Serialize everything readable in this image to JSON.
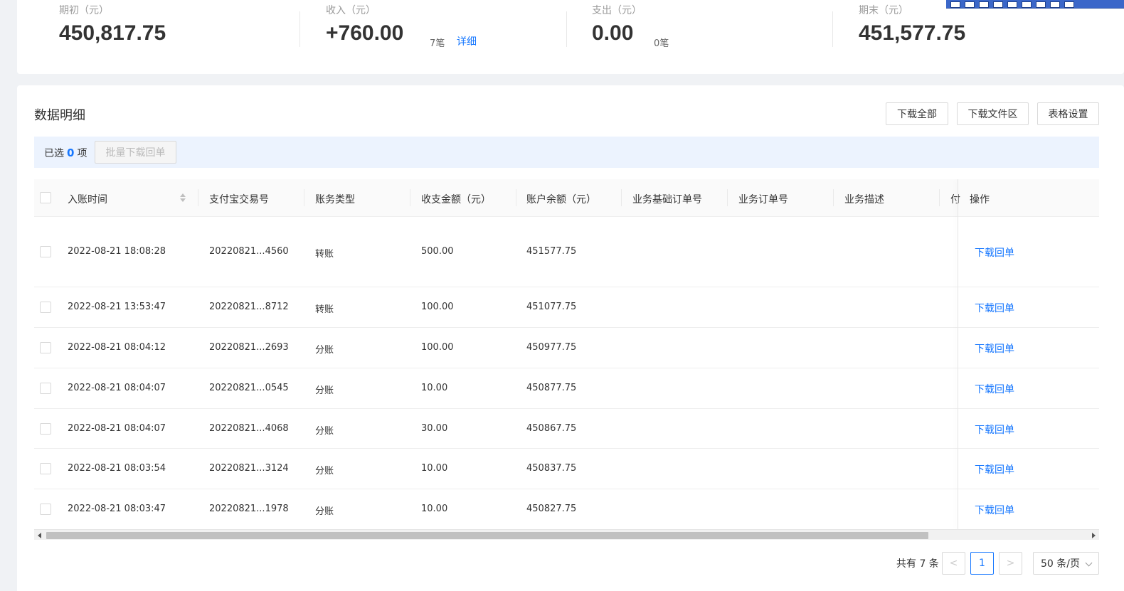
{
  "summary": {
    "opening": {
      "label": "期初（元）",
      "value": "450,817.75"
    },
    "income": {
      "label": "收入（元）",
      "value": "+760.00",
      "count": "7笔",
      "detail": "详细"
    },
    "expense": {
      "label": "支出（元）",
      "value": "0.00",
      "count": "0笔"
    },
    "closing": {
      "label": "期末（元）",
      "value": "451,577.75"
    }
  },
  "section": {
    "title": "数据明细",
    "buttons": {
      "download_all": "下载全部",
      "download_area": "下载文件区",
      "table_settings": "表格设置"
    }
  },
  "selection": {
    "prefix": "已选",
    "count": "0",
    "suffix": "项",
    "batch_button": "批量下载回单"
  },
  "table": {
    "columns": [
      "入账时间",
      "支付宝交易号",
      "账务类型",
      "收支金额（元）",
      "账户余额（元）",
      "业务基础订单号",
      "业务订单号",
      "业务描述",
      "付",
      "操作"
    ],
    "rows": [
      {
        "time": "2022-08-21 18:08:28",
        "trade_no": "20220821...4560",
        "type": "转账",
        "amount": "500.00",
        "balance": "451577.75",
        "action": "下载回单"
      },
      {
        "time": "2022-08-21 13:53:47",
        "trade_no": "20220821...8712",
        "type": "转账",
        "amount": "100.00",
        "balance": "451077.75",
        "action": "下载回单"
      },
      {
        "time": "2022-08-21 08:04:12",
        "trade_no": "20220821...2693",
        "type": "分账",
        "amount": "100.00",
        "balance": "450977.75",
        "action": "下载回单"
      },
      {
        "time": "2022-08-21 08:04:07",
        "trade_no": "20220821...0545",
        "type": "分账",
        "amount": "10.00",
        "balance": "450877.75",
        "action": "下载回单"
      },
      {
        "time": "2022-08-21 08:04:07",
        "trade_no": "20220821...4068",
        "type": "分账",
        "amount": "30.00",
        "balance": "450867.75",
        "action": "下载回单"
      },
      {
        "time": "2022-08-21 08:03:54",
        "trade_no": "20220821...3124",
        "type": "分账",
        "amount": "10.00",
        "balance": "450837.75",
        "action": "下载回单"
      },
      {
        "time": "2022-08-21 08:03:47",
        "trade_no": "20220821...1978",
        "type": "分账",
        "amount": "10.00",
        "balance": "450827.75",
        "action": "下载回单"
      }
    ]
  },
  "pagination": {
    "total": "共有 7 条",
    "prev": "<",
    "current": "1",
    "next": ">",
    "page_size": "50 条/页"
  },
  "colors": {
    "accent": "#1677ff",
    "selection_bg": "#ecf3fe"
  }
}
